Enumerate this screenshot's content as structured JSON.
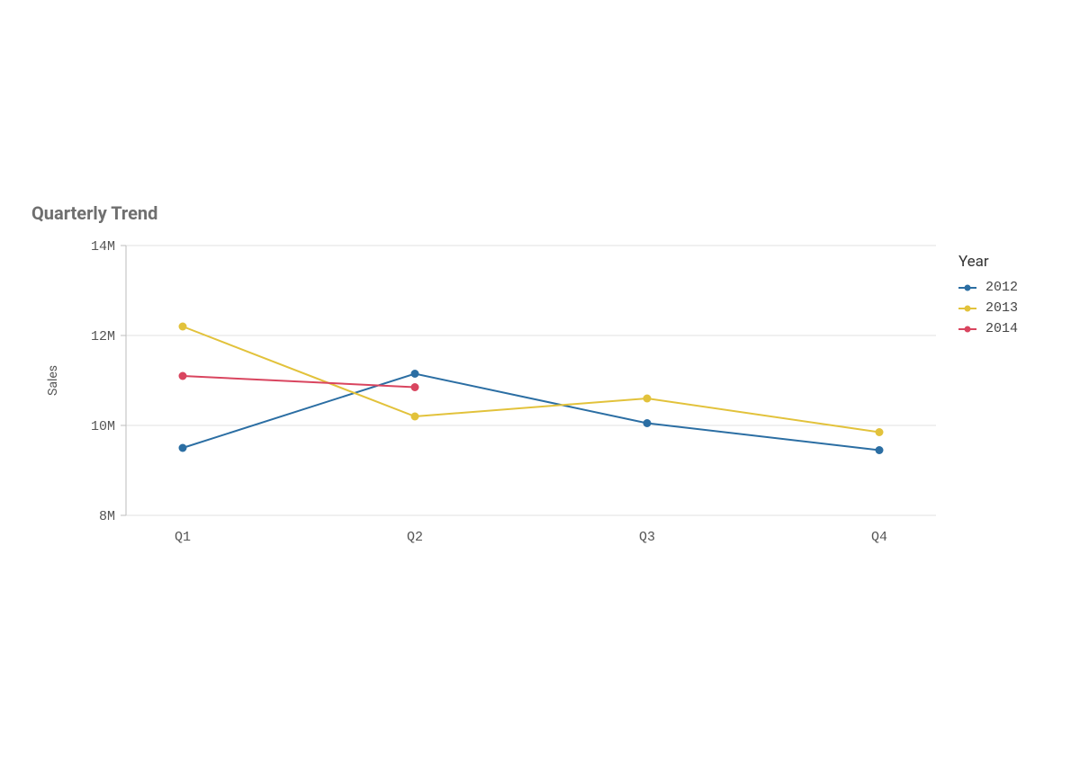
{
  "title": "Quarterly Trend",
  "legend_title": "Year",
  "legend_items": [
    {
      "name": "2012",
      "color": "#2b6ea3"
    },
    {
      "name": "2013",
      "color": "#e2c23b"
    },
    {
      "name": "2014",
      "color": "#d9455f"
    }
  ],
  "y_axis_title": "Sales",
  "y_ticks": [
    "8M",
    "10M",
    "12M",
    "14M"
  ],
  "x_ticks": [
    "Q1",
    "Q2",
    "Q3",
    "Q4"
  ],
  "chart_data": {
    "type": "line",
    "title": "Quarterly Trend",
    "xlabel": "",
    "ylabel": "Sales",
    "categories": [
      "Q1",
      "Q2",
      "Q3",
      "Q4"
    ],
    "ylim": [
      8000000,
      14000000
    ],
    "series": [
      {
        "name": "2012",
        "color": "#2b6ea3",
        "values": [
          9500000,
          11150000,
          10050000,
          9450000
        ]
      },
      {
        "name": "2013",
        "color": "#e2c23b",
        "values": [
          12200000,
          10200000,
          10600000,
          9850000
        ]
      },
      {
        "name": "2014",
        "color": "#d9455f",
        "values": [
          11100000,
          10850000,
          null,
          null
        ]
      }
    ],
    "legend_title": "Year",
    "legend_position": "right",
    "grid": true
  }
}
